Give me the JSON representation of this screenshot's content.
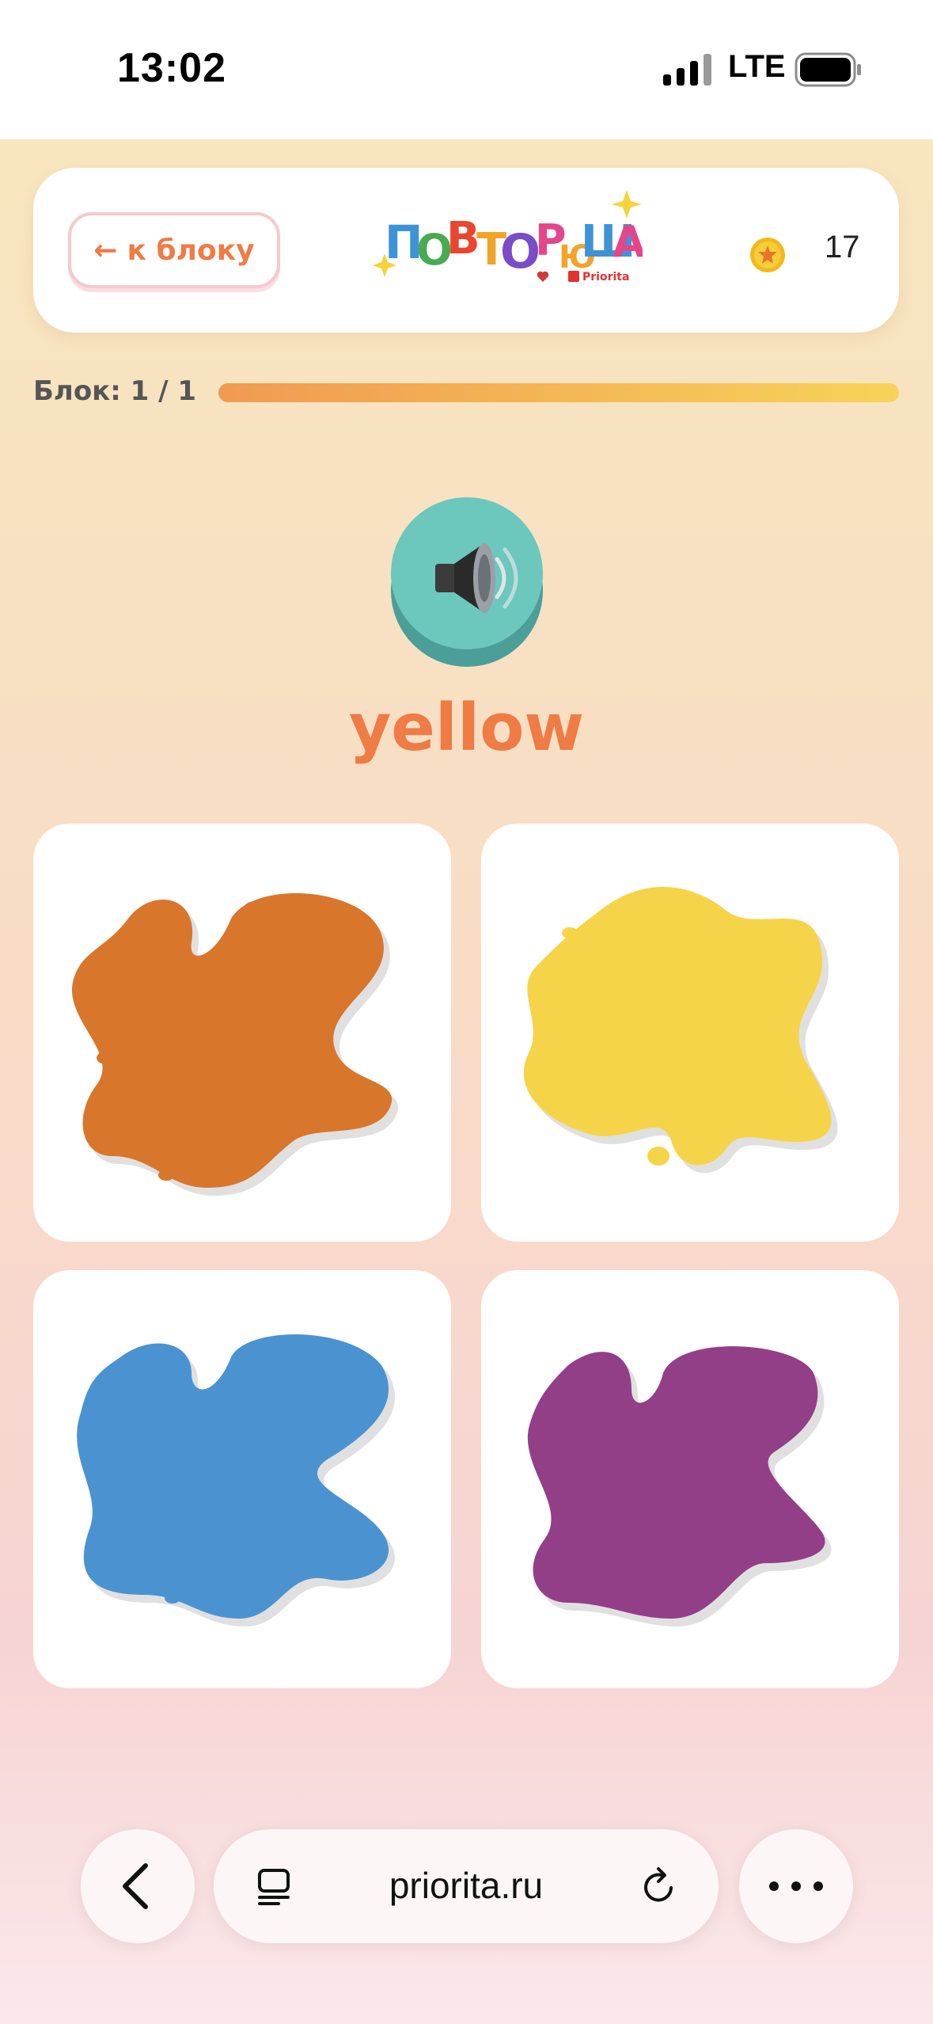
{
  "status_bar": {
    "time": "13:02",
    "network": "LTE"
  },
  "header": {
    "back_label": "к блоку",
    "logo_text": "ПОВТОРЮША",
    "logo_subtext": "Priorita",
    "coins": "17"
  },
  "progress": {
    "label": "Блок: 1 / 1",
    "fraction": 1.0
  },
  "question": {
    "word": "yellow"
  },
  "answers": [
    {
      "color_name": "orange",
      "color": "#d8762c"
    },
    {
      "color_name": "yellow",
      "color": "#f6d44a"
    },
    {
      "color_name": "blue",
      "color": "#4b93d0"
    },
    {
      "color_name": "purple",
      "color": "#923f88"
    }
  ],
  "browser": {
    "url": "priorita.ru"
  },
  "colors": {
    "accent": "#ef7b45",
    "sound_button": "#6cc7bd"
  }
}
